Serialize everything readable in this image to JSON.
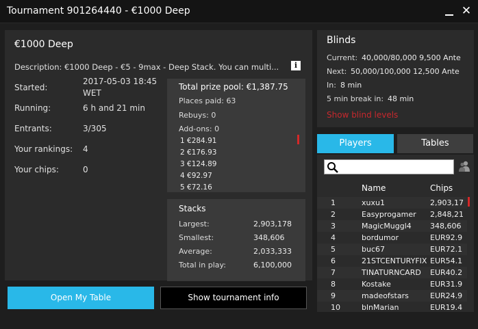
{
  "window": {
    "title": "Tournament 901264440 - €1000 Deep",
    "minimize": "minimize",
    "close": "✕"
  },
  "tournament": {
    "name": "€1000 Deep",
    "description": "Description: €1000 Deep - €5 - 9max - Deep Stack. You can multi...",
    "info_icon": "i",
    "labels": {
      "started": "Started:",
      "running": "Running:",
      "entrants": "Entrants:",
      "rankings": "Your rankings:",
      "chips": "Your chips:"
    },
    "values": {
      "started_line1": "2017-05-03 18:45",
      "started_line2": "WET",
      "running": "6 h and 21 min",
      "entrants": "3/305",
      "rankings": "4",
      "chips": "0"
    }
  },
  "prize": {
    "title": "Total prize pool: €1,387.75",
    "places_paid": "Places paid: 63",
    "rebuys": "Rebuys: 0",
    "addons": "Add-ons: 0",
    "places": [
      "1 €284.91",
      "2 €176.93",
      "3 €124.89",
      "4 €92.97",
      "5 €72.16"
    ]
  },
  "stacks": {
    "title": "Stacks",
    "largest_label": "Largest:",
    "largest": "2,903,178",
    "smallest_label": "Smallest:",
    "smallest": "348,606",
    "average_label": "Average:",
    "average": "2,033,333",
    "total_label": "Total in play:",
    "total": "6,100,000"
  },
  "buttons": {
    "open_table": "Open My Table",
    "show_info": "Show tournament info"
  },
  "blinds": {
    "title": "Blinds",
    "current_label": "Current:",
    "current": "40,000/80,000 9,500 Ante",
    "next_label": "Next:",
    "next": "50,000/100,000 12,500 Ante",
    "in_label": "In:",
    "in": "8 min",
    "break_label": "5 min break in:",
    "break": "48 min",
    "show_levels": "Show blind levels"
  },
  "tabs": {
    "players": "Players",
    "tables": "Tables"
  },
  "players": {
    "search_value": "",
    "col_name": "Name",
    "col_chips": "Chips",
    "rows": [
      {
        "rank": "1",
        "name": "xuxu1",
        "chips": "2,903,17"
      },
      {
        "rank": "2",
        "name": "Easyprogamer",
        "chips": "2,848,21"
      },
      {
        "rank": "3",
        "name": "MagicMuggl4",
        "chips": "348,606"
      },
      {
        "rank": "4",
        "name": "bordumor",
        "chips": "EUR92.9"
      },
      {
        "rank": "5",
        "name": "buc67",
        "chips": "EUR72.1"
      },
      {
        "rank": "6",
        "name": "21STCENTURYFIX",
        "chips": "EUR54.1"
      },
      {
        "rank": "7",
        "name": "TINATURNCARD",
        "chips": "EUR40.2"
      },
      {
        "rank": "8",
        "name": "Kostake",
        "chips": "EUR31.9"
      },
      {
        "rank": "9",
        "name": "madeofstars",
        "chips": "EUR24.9"
      },
      {
        "rank": "10",
        "name": "blnMarian",
        "chips": "EUR19.4"
      }
    ]
  },
  "colors": {
    "accent": "#29b8e8",
    "link_red": "#c8282d",
    "panel": "#2b2b2b",
    "box": "#3a3a3a"
  }
}
